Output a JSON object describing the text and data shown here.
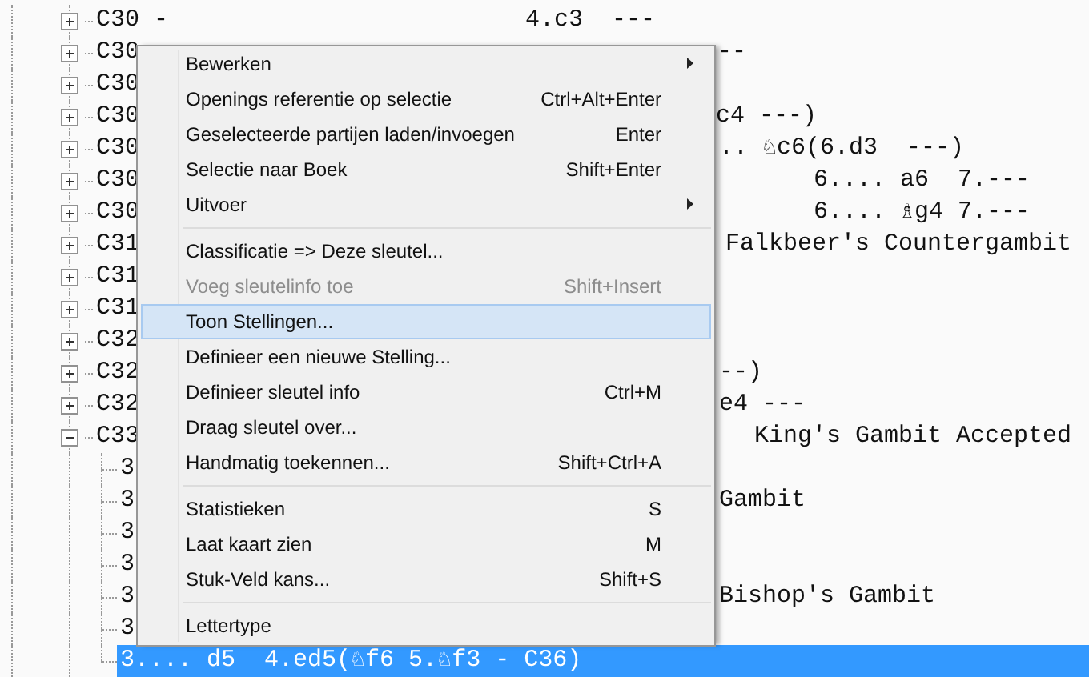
{
  "tree": {
    "rows": [
      {
        "kind": "node",
        "expanded": false,
        "label": "C30 -",
        "continuation": "4.c3  ---",
        "selected": false
      },
      {
        "kind": "node",
        "expanded": false,
        "label": "C30",
        "continuation": "--",
        "selected": false
      },
      {
        "kind": "node",
        "expanded": false,
        "label": "C30",
        "selected": false
      },
      {
        "kind": "node",
        "expanded": false,
        "label": "C30",
        "continuation": "c4 ---)",
        "selected": false
      },
      {
        "kind": "node",
        "expanded": false,
        "label": "C30",
        "continuation": ".. ♘c6(6.d3  ---)",
        "selected": false
      },
      {
        "kind": "node",
        "expanded": false,
        "label": "C30",
        "continuation": "6.... a6  7.---",
        "selected": false
      },
      {
        "kind": "node",
        "expanded": false,
        "label": "C30",
        "continuation": "6.... ♗g4 7.---",
        "selected": false
      },
      {
        "kind": "node",
        "expanded": false,
        "label": "C31",
        "continuation": "Falkbeer's Countergambit",
        "selected": false
      },
      {
        "kind": "node",
        "expanded": false,
        "label": "C31",
        "selected": false
      },
      {
        "kind": "node",
        "expanded": false,
        "label": "C31",
        "selected": false
      },
      {
        "kind": "node",
        "expanded": false,
        "label": "C32",
        "selected": false
      },
      {
        "kind": "node",
        "expanded": false,
        "label": "C32",
        "continuation": "--)",
        "selected": false
      },
      {
        "kind": "node",
        "expanded": false,
        "label": "C32",
        "continuation": "e4 ---",
        "selected": false
      },
      {
        "kind": "node",
        "expanded": true,
        "label": "C33",
        "continuation": "King's Gambit Accepted",
        "selected": false
      },
      {
        "kind": "leaf",
        "label": "3",
        "selected": false
      },
      {
        "kind": "leaf",
        "label": "3",
        "continuation": "Gambit",
        "selected": false
      },
      {
        "kind": "leaf",
        "label": "3",
        "selected": false
      },
      {
        "kind": "leaf",
        "label": "3",
        "selected": false
      },
      {
        "kind": "leaf",
        "label": "3",
        "continuation": "Bishop's Gambit",
        "selected": false
      },
      {
        "kind": "leaf",
        "label": "3",
        "selected": false
      },
      {
        "kind": "leaf",
        "label": "3.... d5  4.ed5(♘f6 5.♘f3 - C36)",
        "selected": true
      }
    ]
  },
  "context_menu": {
    "items": [
      {
        "kind": "item",
        "label": "Bewerken",
        "submenu": true,
        "disabled": false,
        "selected": false
      },
      {
        "kind": "item",
        "label": "Openings referentie op selectie",
        "shortcut": "Ctrl+Alt+Enter",
        "submenu": false,
        "disabled": false,
        "selected": false
      },
      {
        "kind": "item",
        "label": "Geselecteerde partijen laden/invoegen",
        "shortcut": "Enter",
        "submenu": false,
        "disabled": false,
        "selected": false
      },
      {
        "kind": "item",
        "label": "Selectie naar Boek",
        "shortcut": "Shift+Enter",
        "submenu": false,
        "disabled": false,
        "selected": false
      },
      {
        "kind": "item",
        "label": "Uitvoer",
        "submenu": true,
        "disabled": false,
        "selected": false
      },
      {
        "kind": "separator"
      },
      {
        "kind": "item",
        "label": "Classificatie => Deze sleutel...",
        "submenu": false,
        "disabled": false,
        "selected": false
      },
      {
        "kind": "item",
        "label": "Voeg sleutelinfo toe",
        "shortcut": "Shift+Insert",
        "submenu": false,
        "disabled": true,
        "selected": false
      },
      {
        "kind": "item",
        "label": "Toon Stellingen...",
        "submenu": false,
        "disabled": false,
        "selected": true
      },
      {
        "kind": "item",
        "label": "Definieer een nieuwe Stelling...",
        "submenu": false,
        "disabled": false,
        "selected": false
      },
      {
        "kind": "item",
        "label": "Definieer sleutel info",
        "shortcut": "Ctrl+M",
        "submenu": false,
        "disabled": false,
        "selected": false
      },
      {
        "kind": "item",
        "label": "Draag sleutel over...",
        "submenu": false,
        "disabled": false,
        "selected": false
      },
      {
        "kind": "item",
        "label": "Handmatig toekennen...",
        "shortcut": "Shift+Ctrl+A",
        "submenu": false,
        "disabled": false,
        "selected": false
      },
      {
        "kind": "separator"
      },
      {
        "kind": "item",
        "label": "Statistieken",
        "shortcut": "S",
        "submenu": false,
        "disabled": false,
        "selected": false
      },
      {
        "kind": "item",
        "label": "Laat kaart zien",
        "shortcut": "M",
        "submenu": false,
        "disabled": false,
        "selected": false
      },
      {
        "kind": "item",
        "label": "Stuk-Veld kans...",
        "shortcut": "Shift+S",
        "submenu": false,
        "disabled": false,
        "selected": false
      },
      {
        "kind": "separator"
      },
      {
        "kind": "item",
        "label": "Lettertype",
        "submenu": false,
        "disabled": false,
        "selected": false
      }
    ]
  }
}
